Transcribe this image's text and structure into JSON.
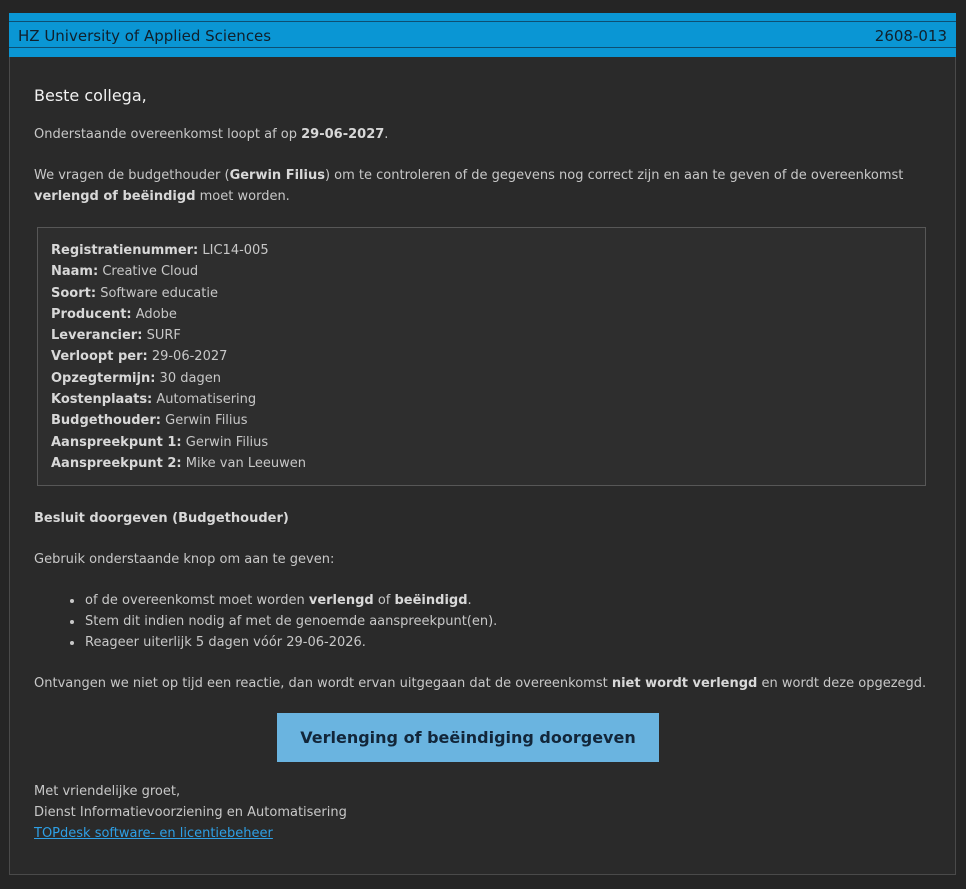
{
  "header": {
    "title": "HZ University of Applied Sciences",
    "code": "2608-013"
  },
  "mail": {
    "greeting": "Beste collega,",
    "intro_prefix": "Onderstaande overeenkomst loopt af op ",
    "intro_date": "29-06-2027",
    "intro_suffix": ".",
    "request_prefix": "We vragen de budgethouder (",
    "request_name": "Gerwin Filius",
    "request_mid": ") om te controleren of de gegevens nog correct zijn en aan te geven of de overeenkomst ",
    "request_bold": "verlengd of beëindigd",
    "request_suffix": " moet worden."
  },
  "details": [
    {
      "label": "Registratienummer:",
      "value": "LIC14-005"
    },
    {
      "label": "Naam:",
      "value": "Creative Cloud"
    },
    {
      "label": "Soort:",
      "value": "Software educatie"
    },
    {
      "label": "Producent:",
      "value": "Adobe"
    },
    {
      "label": "Leverancier:",
      "value": "SURF"
    },
    {
      "label": "Verloopt per:",
      "value": "29-06-2027"
    },
    {
      "label": "Opzegtermijn:",
      "value": "30 dagen"
    },
    {
      "label": "Kostenplaats:",
      "value": "Automatisering"
    },
    {
      "label": "Budgethouder:",
      "value": "Gerwin Filius"
    },
    {
      "label": "Aanspreekpunt 1:",
      "value": "Gerwin Filius"
    },
    {
      "label": "Aanspreekpunt 2:",
      "value": "Mike van Leeuwen"
    }
  ],
  "decision": {
    "title": "Besluit doorgeven (Budgethouder)",
    "instruction": "Gebruik onderstaande knop om aan te geven:",
    "bullet1_prefix": "of de overeenkomst moet worden ",
    "bullet1_bold1": "verlengd",
    "bullet1_mid": " of ",
    "bullet1_bold2": "beëindigd",
    "bullet1_suffix": ".",
    "bullet2": "Stem dit indien nodig af met de genoemde aanspreekpunt(en).",
    "bullet3": "Reageer uiterlijk 5 dagen vóór 29-06-2026.",
    "warning_prefix": "Ontvangen we niet op tijd een reactie, dan wordt ervan uitgegaan dat de overeenkomst ",
    "warning_bold": "niet wordt verlengd",
    "warning_suffix": " en wordt deze opgezegd.",
    "button_label": "Verlenging of beëindiging doorgeven"
  },
  "signature": {
    "closing": "Met vriendelijke groet,",
    "department": "Dienst Informatievoorziening en Automatisering",
    "link_label": "TOPdesk software- en licentiebeheer"
  },
  "colors": {
    "header": "#0a96d4",
    "button": "#6ab4e0",
    "link": "#2ea0e6",
    "background": "#2a2a2a"
  }
}
